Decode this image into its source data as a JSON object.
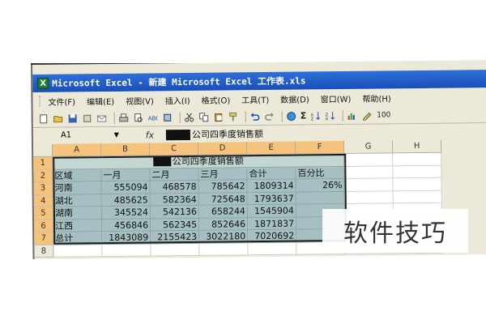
{
  "window": {
    "app_icon": "X",
    "title": "Microsoft Excel - 新建 Microsoft Excel 工作表.xls"
  },
  "menubar": {
    "items": [
      "文件(F)",
      "编辑(E)",
      "视图(V)",
      "插入(I)",
      "格式(O)",
      "工具(T)",
      "数据(D)",
      "窗口(W)",
      "帮助(H)"
    ]
  },
  "toolbar": {
    "icons": [
      "new-icon",
      "open-icon",
      "save-icon",
      "permission-icon",
      "mail-icon",
      "print-icon",
      "print-preview-icon",
      "spelling-icon",
      "research-icon",
      "cut-icon",
      "copy-icon",
      "paste-icon",
      "format-painter-icon",
      "undo-icon",
      "redo-icon",
      "hyperlink-icon",
      "autosum-icon",
      "sort-ascending-icon",
      "sort-descending-icon",
      "chart-wizard-icon",
      "drawing-icon"
    ],
    "sigma": "Σ",
    "zoom": "100"
  },
  "formula_bar": {
    "name_box": "A1",
    "fx": "fx",
    "value_text": "公司四季度销售额"
  },
  "sheet": {
    "columns": [
      "A",
      "B",
      "C",
      "D",
      "E",
      "F",
      "G",
      "H"
    ],
    "selected_columns": [
      "A",
      "B",
      "C",
      "D",
      "E",
      "F"
    ],
    "row_numbers": [
      "1",
      "2",
      "3",
      "4",
      "5",
      "6",
      "7",
      "8"
    ],
    "title": "公司四季度销售额",
    "headers": [
      "区域",
      "一月",
      "二月",
      "三月",
      "合计",
      "百分比"
    ],
    "rows": [
      [
        "河南",
        "555094",
        "468578",
        "785642",
        "1809314",
        "26%"
      ],
      [
        "湖北",
        "485625",
        "582364",
        "725648",
        "1793637",
        ""
      ],
      [
        "湖南",
        "345524",
        "542136",
        "658244",
        "1545904",
        ""
      ],
      [
        "江西",
        "456846",
        "562345",
        "852646",
        "1871837",
        ""
      ],
      [
        "总计",
        "1843089",
        "2155423",
        "3022180",
        "7020692",
        ""
      ]
    ]
  },
  "watermark": "软件技巧"
}
